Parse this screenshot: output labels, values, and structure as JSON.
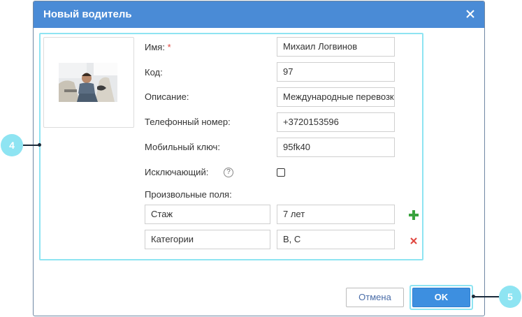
{
  "dialog": {
    "title": "Новый водитель",
    "close_icon": "close-icon"
  },
  "form": {
    "photo_icon": "driver-photo",
    "name": {
      "label": "Имя:",
      "required_mark": "*",
      "value": "Михаил Логвинов"
    },
    "code": {
      "label": "Код:",
      "value": "97"
    },
    "description": {
      "label": "Описание:",
      "value": "Международные перевозки"
    },
    "phone": {
      "label": "Телефонный номер:",
      "value": "+3720153596"
    },
    "mobile_key": {
      "label": "Мобильный ключ:",
      "value": "95fk40"
    },
    "exclusive": {
      "label": "Исключающий:",
      "help": "?",
      "checked": false
    },
    "custom_fields": {
      "label": "Произвольные поля:",
      "rows": [
        {
          "name": "Стаж",
          "value": "7 лет",
          "action_icon": "plus-icon"
        },
        {
          "name": "Категории",
          "value": "B, C",
          "action_icon": "delete-icon"
        }
      ]
    }
  },
  "footer": {
    "cancel_label": "Отмена",
    "ok_label": "OK"
  },
  "annotations": {
    "badge_4": "4",
    "badge_5": "5"
  },
  "colors": {
    "titlebar": "#4a8bd6",
    "highlight": "#8ee4f2",
    "ok_button": "#3d8fe0",
    "required": "#e0463f",
    "add": "#39a33e"
  }
}
